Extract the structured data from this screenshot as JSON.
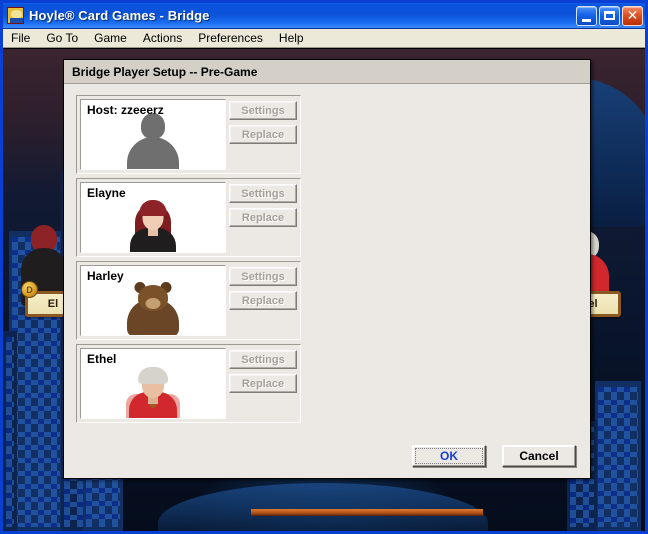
{
  "window": {
    "title": "Hoyle® Card Games - Bridge",
    "icon": "card-jester-icon",
    "controls": {
      "minimize": "minimize-icon",
      "maximize": "maximize-icon",
      "close": "✕"
    }
  },
  "menu": {
    "items": [
      {
        "label": "File"
      },
      {
        "label": "Go To"
      },
      {
        "label": "Game"
      },
      {
        "label": "Actions"
      },
      {
        "label": "Preferences"
      },
      {
        "label": "Help"
      }
    ]
  },
  "background": {
    "left_nameplate": "El",
    "right_nameplate": "el",
    "dealer_chip": "D"
  },
  "dialog": {
    "title": "Bridge Player Setup -- Pre-Game",
    "players": [
      {
        "name": "Host: zzeeerz",
        "avatar": "silhouette-avatar",
        "settings_label": "Settings",
        "replace_label": "Replace",
        "buttons_enabled": false
      },
      {
        "name": "Elayne",
        "avatar": "elayne-avatar",
        "settings_label": "Settings",
        "replace_label": "Replace",
        "buttons_enabled": false
      },
      {
        "name": "Harley",
        "avatar": "harley-bear-avatar",
        "settings_label": "Settings",
        "replace_label": "Replace",
        "buttons_enabled": false
      },
      {
        "name": "Ethel",
        "avatar": "ethel-avatar",
        "settings_label": "Settings",
        "replace_label": "Replace",
        "buttons_enabled": false
      }
    ],
    "footer": {
      "ok_label": "OK",
      "cancel_label": "Cancel"
    }
  },
  "colors": {
    "titlebar_blue": "#0b52d8",
    "window_border": "#0a3fd4",
    "menubar": "#ece9d8",
    "dialog_face": "#ece9e4",
    "dialog_titlebar": "#d4d0c8",
    "disabled_text": "#a3a09a",
    "default_button_text": "#1a3fd0",
    "close_button_red": "#e05224"
  }
}
